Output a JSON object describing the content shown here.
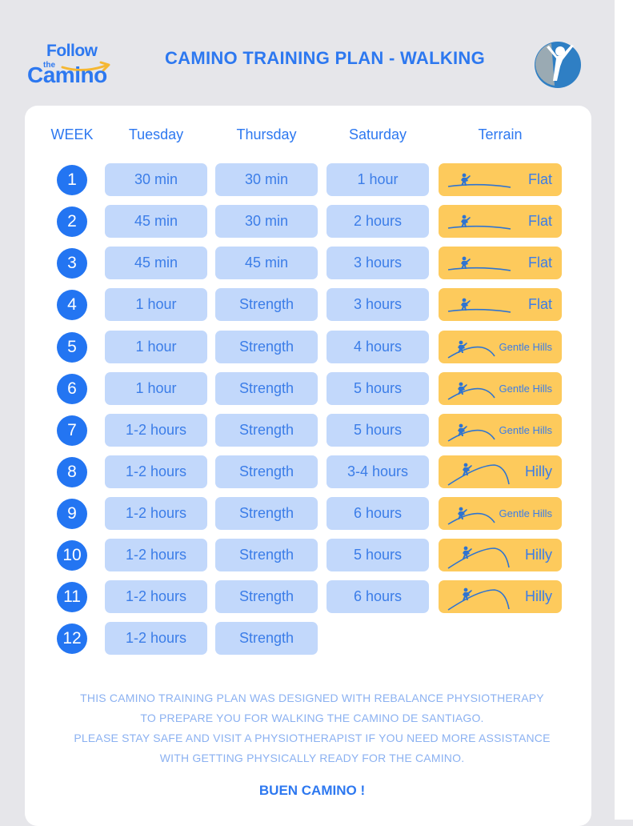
{
  "brand": {
    "logo_follow": "Follow",
    "logo_the": "the",
    "logo_camino": "Camino",
    "partner_logo": "physiotherapy-figure-logo"
  },
  "title": "CAMINO TRAINING PLAN - WALKING",
  "colors": {
    "accent": "#2d78f0",
    "cell_bg": "#c2d8fb",
    "terrain_bg": "#fdca5c",
    "week_badge": "#2375f2",
    "page_bg": "#e6e6ea"
  },
  "table": {
    "headers": [
      "WEEK",
      "Tuesday",
      "Thursday",
      "Saturday",
      "Terrain"
    ],
    "rows": [
      {
        "week": "1",
        "tuesday": "30 min",
        "thursday": "30 min",
        "saturday": "1 hour",
        "terrain": "Flat",
        "terrain_icon": "flat-walker-icon"
      },
      {
        "week": "2",
        "tuesday": "45 min",
        "thursday": "30 min",
        "saturday": "2 hours",
        "terrain": "Flat",
        "terrain_icon": "flat-walker-icon"
      },
      {
        "week": "3",
        "tuesday": "45 min",
        "thursday": "45 min",
        "saturday": "3 hours",
        "terrain": "Flat",
        "terrain_icon": "flat-walker-icon"
      },
      {
        "week": "4",
        "tuesday": "1 hour",
        "thursday": "Strength",
        "saturday": "3 hours",
        "terrain": "Flat",
        "terrain_icon": "flat-walker-icon"
      },
      {
        "week": "5",
        "tuesday": "1 hour",
        "thursday": "Strength",
        "saturday": "4 hours",
        "terrain": "Gentle Hills",
        "terrain_icon": "gentle-hill-walker-icon"
      },
      {
        "week": "6",
        "tuesday": "1 hour",
        "thursday": "Strength",
        "saturday": "5 hours",
        "terrain": "Gentle Hills",
        "terrain_icon": "gentle-hill-walker-icon"
      },
      {
        "week": "7",
        "tuesday": "1-2 hours",
        "thursday": "Strength",
        "saturday": "5 hours",
        "terrain": "Gentle Hills",
        "terrain_icon": "gentle-hill-walker-icon"
      },
      {
        "week": "8",
        "tuesday": "1-2 hours",
        "thursday": "Strength",
        "saturday": "3-4 hours",
        "terrain": "Hilly",
        "terrain_icon": "hill-walker-icon"
      },
      {
        "week": "9",
        "tuesday": "1-2 hours",
        "thursday": "Strength",
        "saturday": "6 hours",
        "terrain": "Gentle Hills",
        "terrain_icon": "gentle-hill-walker-icon"
      },
      {
        "week": "10",
        "tuesday": "1-2 hours",
        "thursday": "Strength",
        "saturday": "5 hours",
        "terrain": "Hilly",
        "terrain_icon": "hill-walker-icon"
      },
      {
        "week": "11",
        "tuesday": "1-2 hours",
        "thursday": "Strength",
        "saturday": "6 hours",
        "terrain": "Hilly",
        "terrain_icon": "hill-walker-icon"
      },
      {
        "week": "12",
        "tuesday": "1-2 hours",
        "thursday": "Strength",
        "saturday": null,
        "terrain": null,
        "terrain_icon": null
      }
    ]
  },
  "footer": {
    "lines": [
      "THIS CAMINO TRAINING PLAN WAS DESIGNED WITH REBALANCE PHYSIOTHERAPY",
      "TO PREPARE YOU FOR WALKING THE CAMINO DE SANTIAGO.",
      "PLEASE STAY SAFE AND VISIT A PHYSIOTHERAPIST IF YOU NEED MORE ASSISTANCE",
      "WITH GETTING PHYSICALLY READY FOR THE CAMINO."
    ],
    "sign_off": "BUEN CAMINO !"
  }
}
